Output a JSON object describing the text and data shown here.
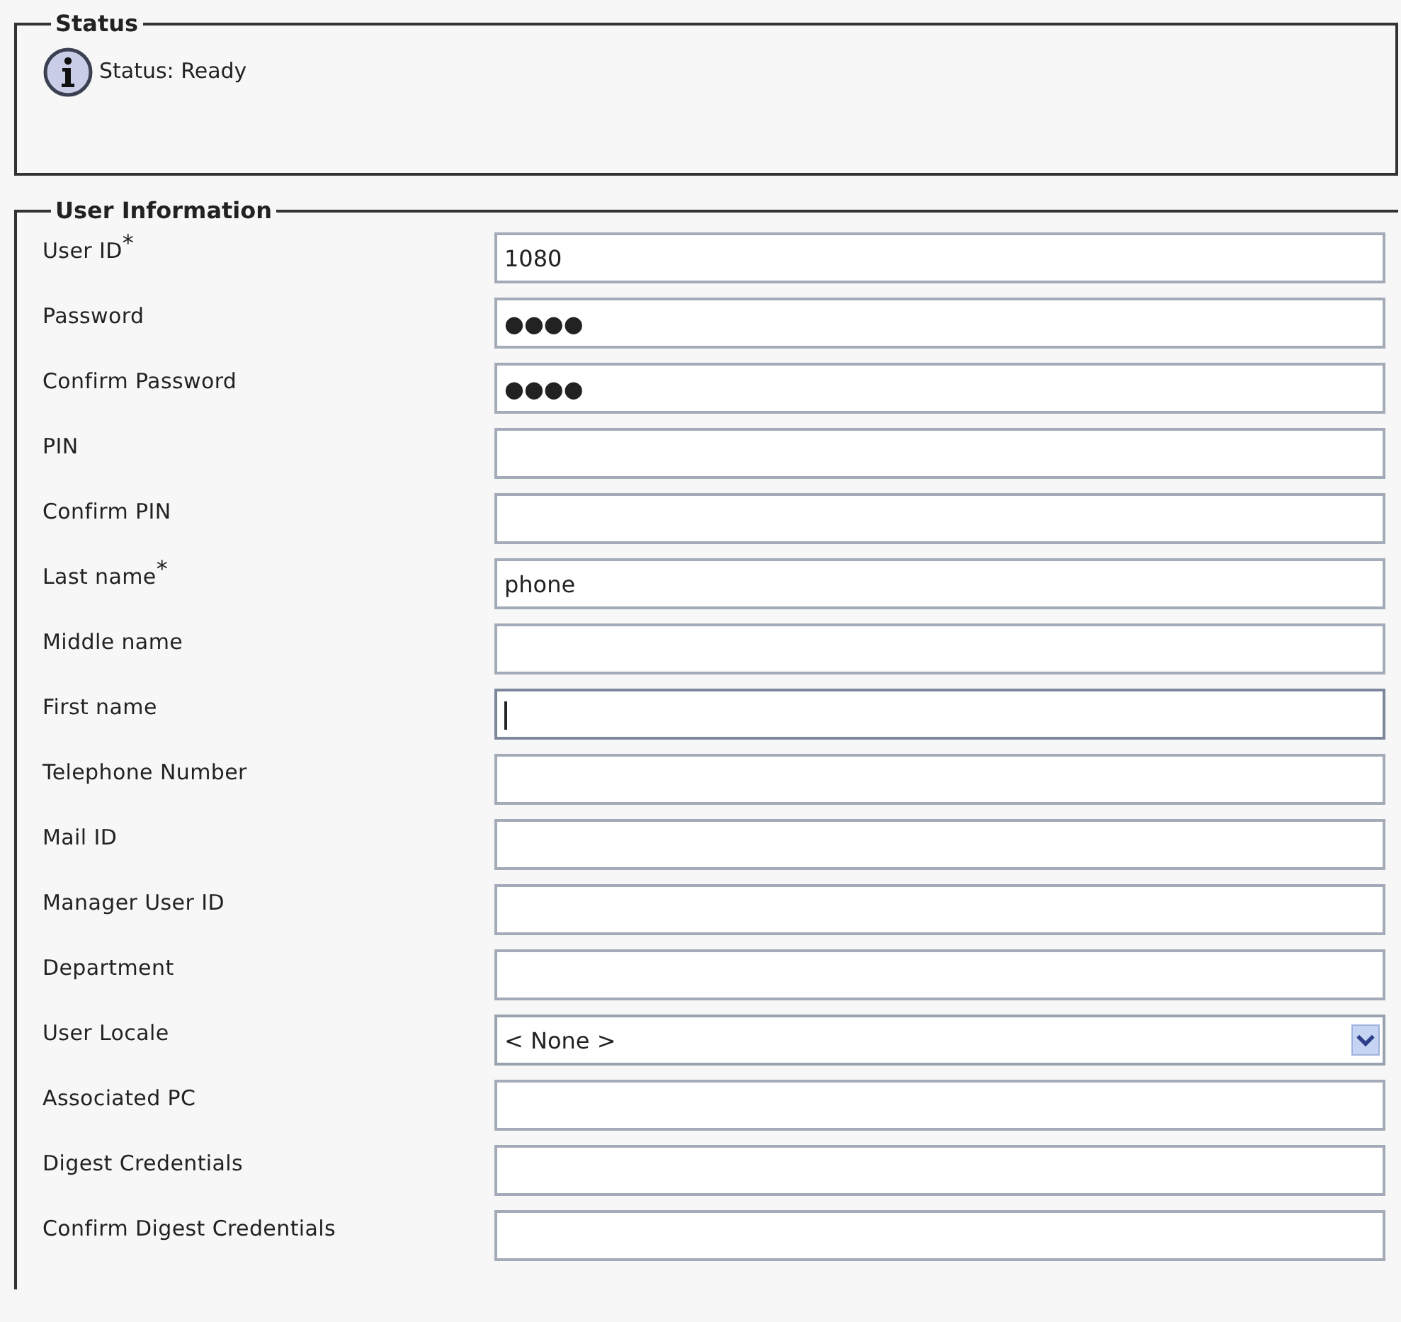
{
  "status": {
    "title": "Status",
    "message": "Status: Ready"
  },
  "user_information": {
    "title": "User Information",
    "fields": [
      {
        "label": "User ID$^{*}$",
        "kind": "text",
        "value": "1080",
        "focused": false
      },
      {
        "label": "Password",
        "kind": "text",
        "value": "●●●●",
        "focused": false
      },
      {
        "label": "Confirm Password",
        "kind": "text",
        "value": "●●●●",
        "focused": false
      },
      {
        "label": "PIN",
        "kind": "text",
        "focused": false
      },
      {
        "label": "Confirm PIN",
        "kind": "text",
        "focused": false
      },
      {
        "label": "Last name$^{*}$",
        "kind": "text",
        "value": "phone",
        "focused": false
      },
      {
        "label": "Middle name",
        "kind": "text",
        "focused": false
      },
      {
        "label": "First name",
        "kind": "text",
        "focused": true
      },
      {
        "label": "Telephone Number",
        "kind": "text",
        "focused": false
      },
      {
        "label": "Mail ID",
        "kind": "text",
        "focused": false
      },
      {
        "label": "Manager User ID",
        "kind": "text",
        "focused": false
      },
      {
        "label": "Department",
        "kind": "text",
        "focused": false
      },
      {
        "label": "User Locale",
        "kind": "select",
        "value": "< None >",
        "focused": false
      },
      {
        "label": "Associated PC",
        "kind": "text",
        "focused": false
      },
      {
        "label": "Digest Credentials",
        "kind": "text",
        "focused": false
      },
      {
        "label": "Confirm Digest Credentials",
        "kind": "text",
        "focused": false
      }
    ]
  }
}
